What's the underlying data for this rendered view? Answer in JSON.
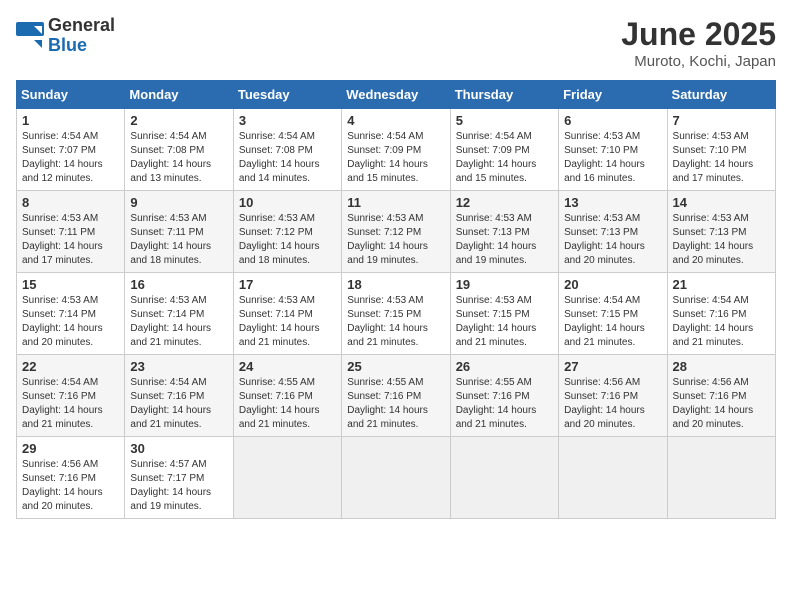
{
  "logo": {
    "general": "General",
    "blue": "Blue"
  },
  "title": "June 2025",
  "subtitle": "Muroto, Kochi, Japan",
  "days_header": [
    "Sunday",
    "Monday",
    "Tuesday",
    "Wednesday",
    "Thursday",
    "Friday",
    "Saturday"
  ],
  "weeks": [
    [
      {
        "num": "1",
        "info": "Sunrise: 4:54 AM\nSunset: 7:07 PM\nDaylight: 14 hours\nand 12 minutes."
      },
      {
        "num": "2",
        "info": "Sunrise: 4:54 AM\nSunset: 7:08 PM\nDaylight: 14 hours\nand 13 minutes."
      },
      {
        "num": "3",
        "info": "Sunrise: 4:54 AM\nSunset: 7:08 PM\nDaylight: 14 hours\nand 14 minutes."
      },
      {
        "num": "4",
        "info": "Sunrise: 4:54 AM\nSunset: 7:09 PM\nDaylight: 14 hours\nand 15 minutes."
      },
      {
        "num": "5",
        "info": "Sunrise: 4:54 AM\nSunset: 7:09 PM\nDaylight: 14 hours\nand 15 minutes."
      },
      {
        "num": "6",
        "info": "Sunrise: 4:53 AM\nSunset: 7:10 PM\nDaylight: 14 hours\nand 16 minutes."
      },
      {
        "num": "7",
        "info": "Sunrise: 4:53 AM\nSunset: 7:10 PM\nDaylight: 14 hours\nand 17 minutes."
      }
    ],
    [
      {
        "num": "8",
        "info": "Sunrise: 4:53 AM\nSunset: 7:11 PM\nDaylight: 14 hours\nand 17 minutes."
      },
      {
        "num": "9",
        "info": "Sunrise: 4:53 AM\nSunset: 7:11 PM\nDaylight: 14 hours\nand 18 minutes."
      },
      {
        "num": "10",
        "info": "Sunrise: 4:53 AM\nSunset: 7:12 PM\nDaylight: 14 hours\nand 18 minutes."
      },
      {
        "num": "11",
        "info": "Sunrise: 4:53 AM\nSunset: 7:12 PM\nDaylight: 14 hours\nand 19 minutes."
      },
      {
        "num": "12",
        "info": "Sunrise: 4:53 AM\nSunset: 7:13 PM\nDaylight: 14 hours\nand 19 minutes."
      },
      {
        "num": "13",
        "info": "Sunrise: 4:53 AM\nSunset: 7:13 PM\nDaylight: 14 hours\nand 20 minutes."
      },
      {
        "num": "14",
        "info": "Sunrise: 4:53 AM\nSunset: 7:13 PM\nDaylight: 14 hours\nand 20 minutes."
      }
    ],
    [
      {
        "num": "15",
        "info": "Sunrise: 4:53 AM\nSunset: 7:14 PM\nDaylight: 14 hours\nand 20 minutes."
      },
      {
        "num": "16",
        "info": "Sunrise: 4:53 AM\nSunset: 7:14 PM\nDaylight: 14 hours\nand 21 minutes."
      },
      {
        "num": "17",
        "info": "Sunrise: 4:53 AM\nSunset: 7:14 PM\nDaylight: 14 hours\nand 21 minutes."
      },
      {
        "num": "18",
        "info": "Sunrise: 4:53 AM\nSunset: 7:15 PM\nDaylight: 14 hours\nand 21 minutes."
      },
      {
        "num": "19",
        "info": "Sunrise: 4:53 AM\nSunset: 7:15 PM\nDaylight: 14 hours\nand 21 minutes."
      },
      {
        "num": "20",
        "info": "Sunrise: 4:54 AM\nSunset: 7:15 PM\nDaylight: 14 hours\nand 21 minutes."
      },
      {
        "num": "21",
        "info": "Sunrise: 4:54 AM\nSunset: 7:16 PM\nDaylight: 14 hours\nand 21 minutes."
      }
    ],
    [
      {
        "num": "22",
        "info": "Sunrise: 4:54 AM\nSunset: 7:16 PM\nDaylight: 14 hours\nand 21 minutes."
      },
      {
        "num": "23",
        "info": "Sunrise: 4:54 AM\nSunset: 7:16 PM\nDaylight: 14 hours\nand 21 minutes."
      },
      {
        "num": "24",
        "info": "Sunrise: 4:55 AM\nSunset: 7:16 PM\nDaylight: 14 hours\nand 21 minutes."
      },
      {
        "num": "25",
        "info": "Sunrise: 4:55 AM\nSunset: 7:16 PM\nDaylight: 14 hours\nand 21 minutes."
      },
      {
        "num": "26",
        "info": "Sunrise: 4:55 AM\nSunset: 7:16 PM\nDaylight: 14 hours\nand 21 minutes."
      },
      {
        "num": "27",
        "info": "Sunrise: 4:56 AM\nSunset: 7:16 PM\nDaylight: 14 hours\nand 20 minutes."
      },
      {
        "num": "28",
        "info": "Sunrise: 4:56 AM\nSunset: 7:16 PM\nDaylight: 14 hours\nand 20 minutes."
      }
    ],
    [
      {
        "num": "29",
        "info": "Sunrise: 4:56 AM\nSunset: 7:16 PM\nDaylight: 14 hours\nand 20 minutes."
      },
      {
        "num": "30",
        "info": "Sunrise: 4:57 AM\nSunset: 7:17 PM\nDaylight: 14 hours\nand 19 minutes."
      },
      {
        "num": "",
        "info": ""
      },
      {
        "num": "",
        "info": ""
      },
      {
        "num": "",
        "info": ""
      },
      {
        "num": "",
        "info": ""
      },
      {
        "num": "",
        "info": ""
      }
    ]
  ]
}
